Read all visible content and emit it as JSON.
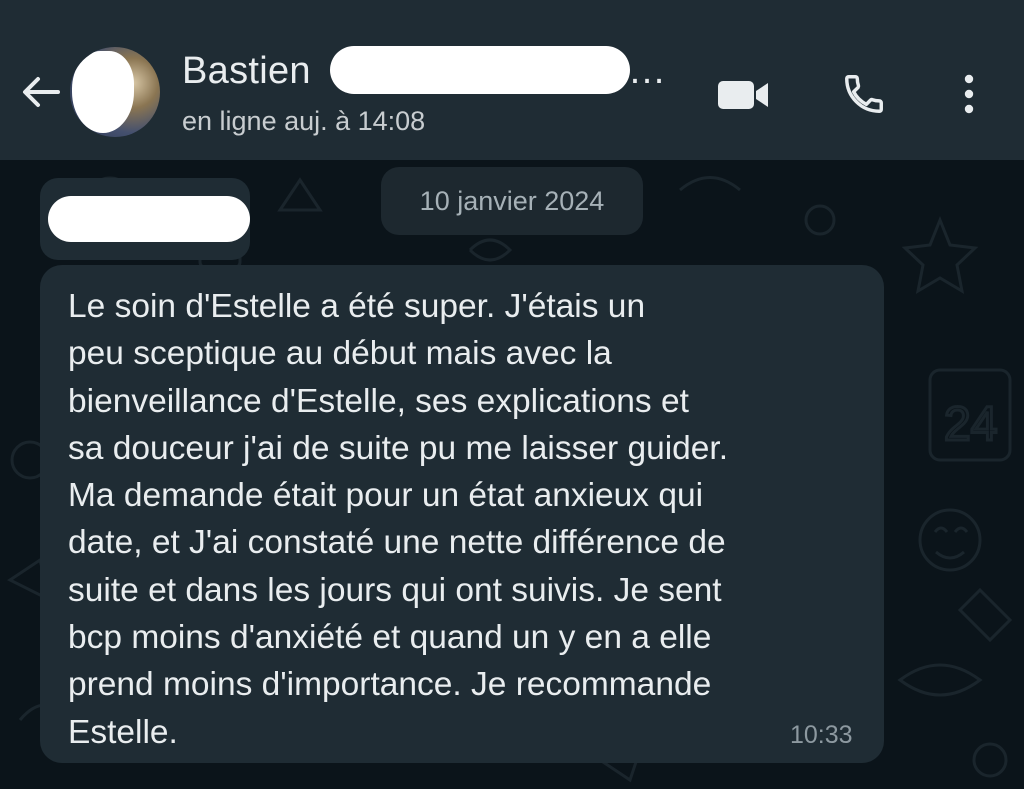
{
  "header": {
    "contact_name": "Bastien",
    "name_tail": "…",
    "status": "en ligne auj. à 14:08",
    "icons": {
      "back": "back-arrow-icon",
      "video": "video-camera-icon",
      "call": "phone-icon",
      "menu": "more-vertical-icon"
    }
  },
  "chat": {
    "date_chip": "10 janvier 2024",
    "message": {
      "text": "Le soin d'Estelle a été super. J'étais un\npeu sceptique au début mais avec la\nbienveillance d'Estelle, ses explications et\nsa douceur j'ai de suite pu me laisser guider.\nMa demande était pour un état anxieux qui\ndate, et J'ai constaté une nette différence de\nsuite et dans les jours qui ont suivis. Je sent\nbcp moins d'anxiété et quand un y en a elle\nprend moins d'importance. Je recommande\nEstelle.",
      "time": "10:33"
    }
  },
  "colors": {
    "header_bg": "#1f2c34",
    "chat_bg": "#0b141a",
    "bubble_bg": "#1f2c34",
    "text": "#e9edef",
    "muted": "#8d99a0"
  }
}
